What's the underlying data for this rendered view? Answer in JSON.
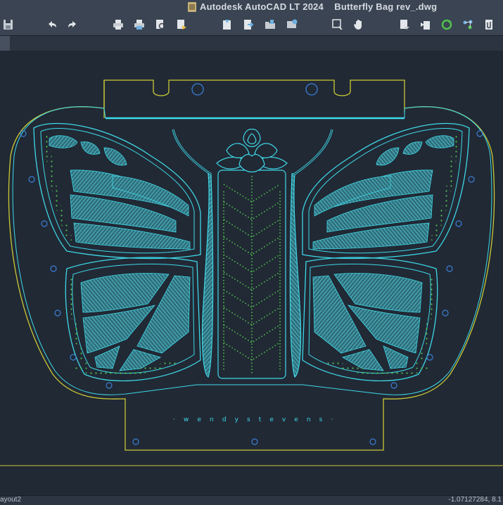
{
  "window": {
    "app_title": "Autodesk AutoCAD LT 2024",
    "document_name": "Butterfly Bag rev_.dwg"
  },
  "toolbar": {
    "buttons": [
      {
        "name": "save-as-button",
        "icon": "save-icon"
      },
      {
        "name": "undo-button",
        "icon": "undo-icon"
      },
      {
        "name": "redo-button",
        "icon": "redo-icon"
      },
      {
        "name": "plot-button",
        "icon": "printer-icon"
      },
      {
        "name": "batch-plot-button",
        "icon": "printer-icon"
      },
      {
        "name": "plot-preview-button",
        "icon": "preview-icon"
      },
      {
        "name": "publish-button",
        "icon": "publish-icon"
      },
      {
        "name": "sheet-set-button",
        "icon": "sheet-icon"
      },
      {
        "name": "export-button",
        "icon": "export-icon"
      },
      {
        "name": "open-folder-button",
        "icon": "folder-icon"
      },
      {
        "name": "design-center-button",
        "icon": "design-center-icon"
      },
      {
        "name": "zoom-window-button",
        "icon": "zoom-window-icon"
      },
      {
        "name": "pan-button",
        "icon": "pan-hand-icon"
      },
      {
        "name": "layer-properties-button",
        "icon": "layers-icon"
      },
      {
        "name": "match-properties-button",
        "icon": "match-properties-icon"
      },
      {
        "name": "refresh-button",
        "icon": "refresh-icon"
      },
      {
        "name": "group-button",
        "icon": "group-icon"
      },
      {
        "name": "attach-file-button",
        "icon": "attach-icon"
      }
    ]
  },
  "drawing": {
    "credit_text": "· w e n d y   s t e v e n s ·",
    "colors": {
      "background": "#212935",
      "outline": "#c9c935",
      "wing": "#3ed8e6",
      "fill": "#3a8a96",
      "dots": "#4fc24c",
      "holes": "#3a7fd6"
    }
  },
  "status": {
    "layout_tab": "ayout2",
    "coords": "-1.07127284, 8.1"
  }
}
